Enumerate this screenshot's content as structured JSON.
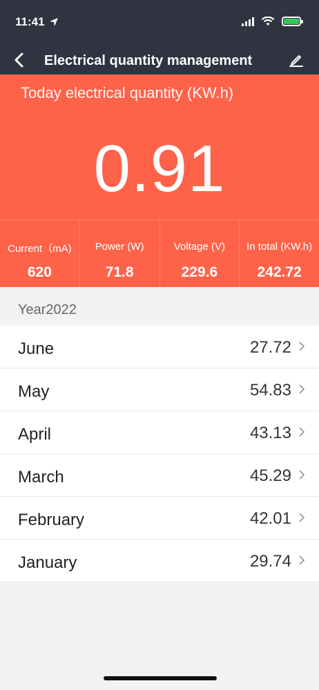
{
  "status_bar": {
    "time": "11:41"
  },
  "nav": {
    "title": "Electrical quantity management"
  },
  "hero": {
    "label": "Today electrical quantity (KW.h)",
    "value": "0.91"
  },
  "stats": [
    {
      "label": "Current（mA)",
      "value": "620"
    },
    {
      "label": "Power (W)",
      "value": "71.8"
    },
    {
      "label": "Voltage (V)",
      "value": "229.6"
    },
    {
      "label": "In total (KW.h)",
      "value": "242.72"
    }
  ],
  "section": {
    "title": "Year2022"
  },
  "months": [
    {
      "label": "June",
      "value": "27.72"
    },
    {
      "label": "May",
      "value": "54.83"
    },
    {
      "label": "April",
      "value": "43.13"
    },
    {
      "label": "March",
      "value": "45.29"
    },
    {
      "label": "February",
      "value": "42.01"
    },
    {
      "label": "January",
      "value": "29.74"
    }
  ],
  "colors": {
    "accent": "#fe634a",
    "header": "#2f3440",
    "battery": "#34c759"
  }
}
